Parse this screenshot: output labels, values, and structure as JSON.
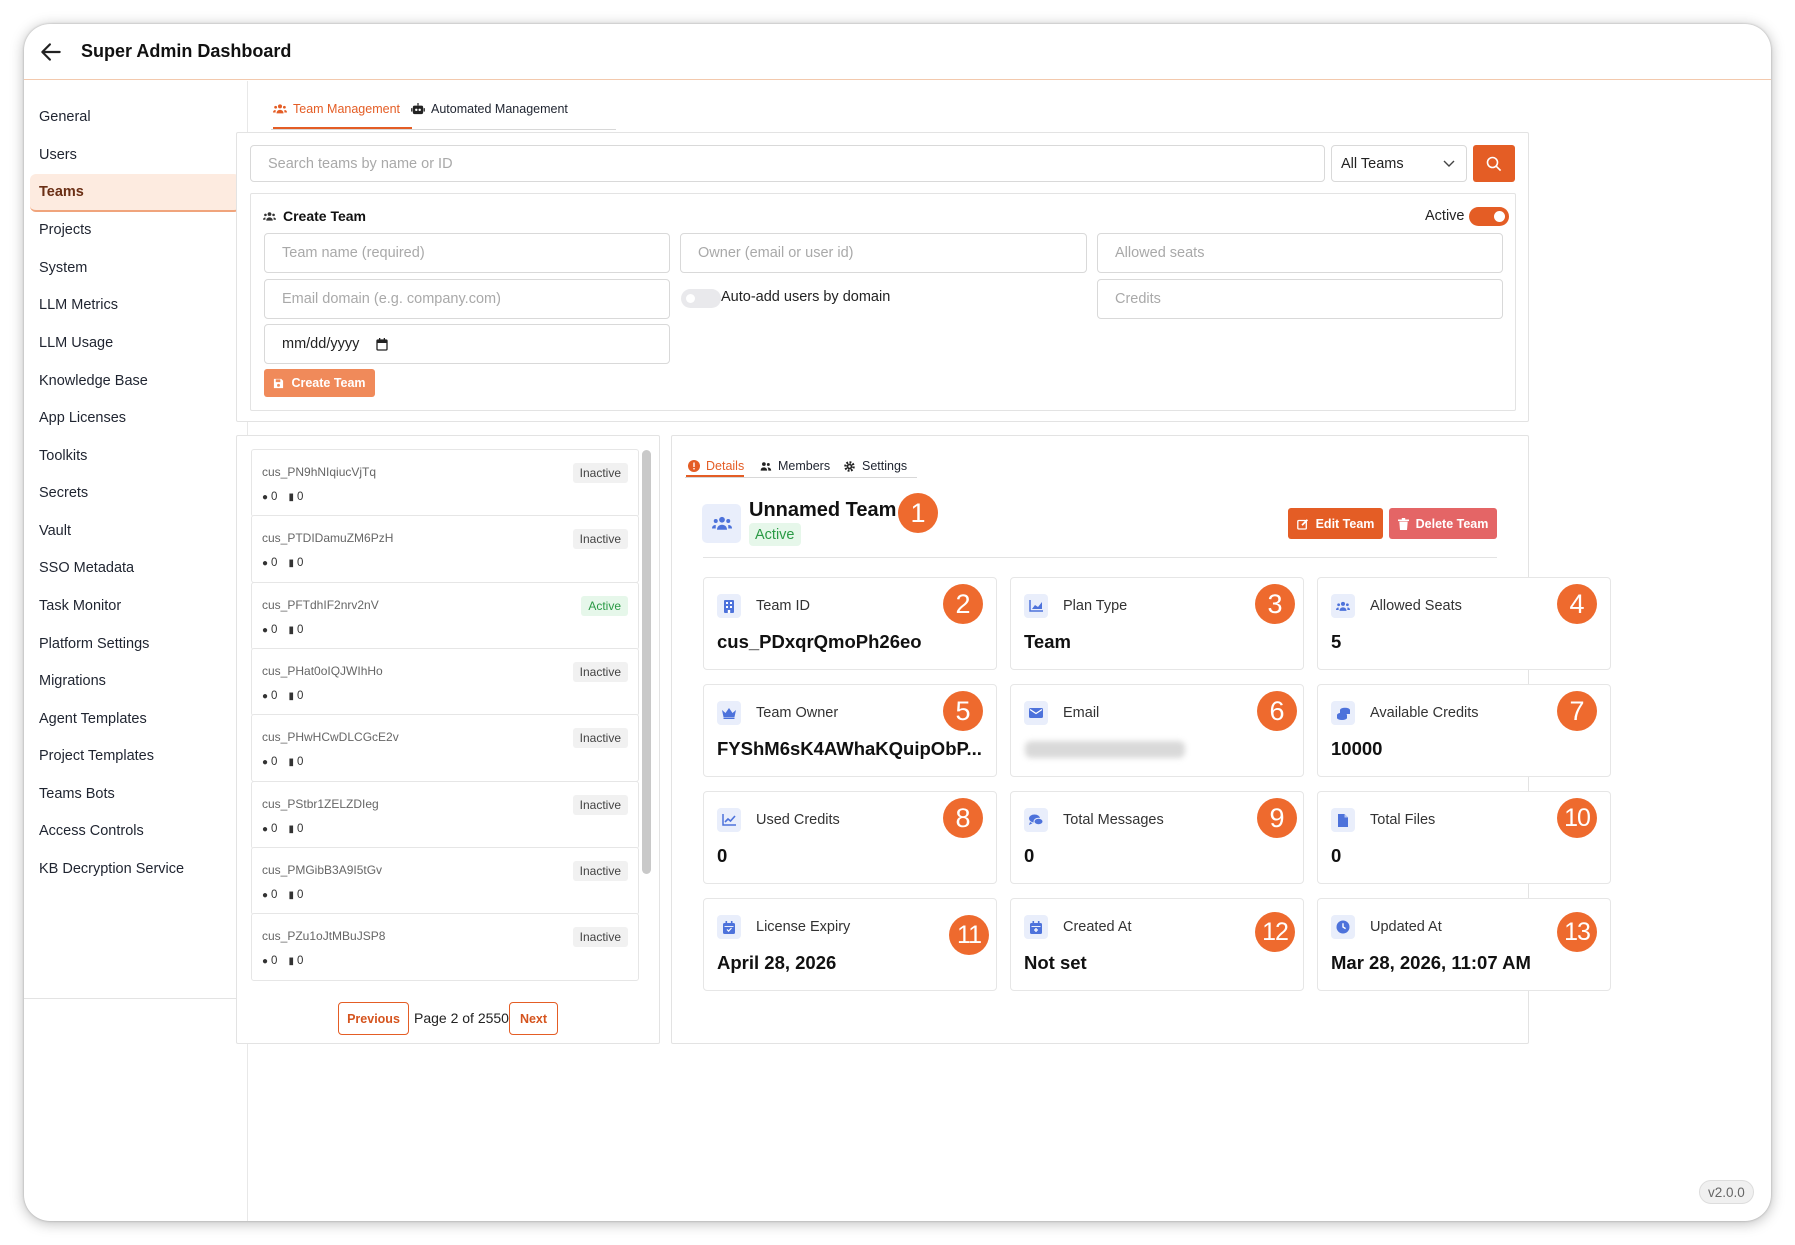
{
  "app": {
    "title": "Super Admin Dashboard",
    "version": "v2.0.0"
  },
  "sidebar": {
    "items": [
      {
        "label": "General"
      },
      {
        "label": "Users"
      },
      {
        "label": "Teams",
        "active": true
      },
      {
        "label": "Projects"
      },
      {
        "label": "System"
      },
      {
        "label": "LLM Metrics"
      },
      {
        "label": "LLM Usage"
      },
      {
        "label": "Knowledge Base"
      },
      {
        "label": "App Licenses"
      },
      {
        "label": "Toolkits"
      },
      {
        "label": "Secrets"
      },
      {
        "label": "Vault"
      },
      {
        "label": "SSO Metadata"
      },
      {
        "label": "Task Monitor"
      },
      {
        "label": "Platform Settings"
      },
      {
        "label": "Migrations"
      },
      {
        "label": "Agent Templates"
      },
      {
        "label": "Project Templates"
      },
      {
        "label": "Teams Bots"
      },
      {
        "label": "Access Controls"
      },
      {
        "label": "KB Decryption Service"
      }
    ]
  },
  "tabs": {
    "team_management": "Team Management",
    "automated_management": "Automated Management"
  },
  "search": {
    "placeholder": "Search teams by name or ID",
    "filter_value": "All Teams"
  },
  "create_team": {
    "heading": "Create Team",
    "active_label": "Active",
    "team_name_placeholder": "Team name (required)",
    "owner_placeholder": "Owner (email or user id)",
    "seats_placeholder": "Allowed seats",
    "email_domain_placeholder": "Email domain (e.g. company.com)",
    "auto_add_label": "Auto-add users by domain",
    "credits_placeholder": "Credits",
    "date_placeholder": "mm/dd/yyyy",
    "submit_label": "Create Team"
  },
  "team_list": {
    "items": [
      {
        "id": "cus_PN9hNIqiucVjTq",
        "status": "Inactive",
        "messages": "0",
        "files": "0"
      },
      {
        "id": "cus_PTDIDamuZM6PzH",
        "status": "Inactive",
        "messages": "0",
        "files": "0"
      },
      {
        "id": "cus_PFTdhIF2nrv2nV",
        "status": "Active",
        "messages": "0",
        "files": "0"
      },
      {
        "id": "cus_PHat0oIQJWIhHo",
        "status": "Inactive",
        "messages": "0",
        "files": "0"
      },
      {
        "id": "cus_PHwHCwDLCGcE2v",
        "status": "Inactive",
        "messages": "0",
        "files": "0"
      },
      {
        "id": "cus_PStbr1ZELZDIeg",
        "status": "Inactive",
        "messages": "0",
        "files": "0"
      },
      {
        "id": "cus_PMGibB3A9I5tGv",
        "status": "Inactive",
        "messages": "0",
        "files": "0"
      },
      {
        "id": "cus_PZu1oJtMBuJSP8",
        "status": "Inactive",
        "messages": "0",
        "files": "0"
      }
    ],
    "pagination": {
      "previous": "Previous",
      "page_text": "Page 2 of 2550",
      "next": "Next"
    }
  },
  "details": {
    "tabs": {
      "details": "Details",
      "members": "Members",
      "settings": "Settings"
    },
    "team_name": "Unnamed Team",
    "status": "Active",
    "edit_label": "Edit Team",
    "delete_label": "Delete Team",
    "name_marker": "1",
    "cards": [
      {
        "label": "Team ID",
        "value": "cus_PDxqrQmoPh26eo",
        "marker": "2",
        "icon": "building-icon"
      },
      {
        "label": "Plan Type",
        "value": "Team",
        "marker": "3",
        "icon": "chart-area-icon"
      },
      {
        "label": "Allowed Seats",
        "value": "5",
        "marker": "4",
        "icon": "users-icon"
      },
      {
        "label": "Team Owner",
        "value": "FYShM6sK4AWhaKQuipObP...",
        "marker": "5",
        "icon": "crown-icon"
      },
      {
        "label": "Email",
        "value": "",
        "marker": "6",
        "icon": "envelope-icon",
        "blurred": true
      },
      {
        "label": "Available Credits",
        "value": "10000",
        "marker": "7",
        "icon": "coins-icon"
      },
      {
        "label": "Used Credits",
        "value": "0",
        "marker": "8",
        "icon": "chart-line-icon"
      },
      {
        "label": "Total Messages",
        "value": "0",
        "marker": "9",
        "icon": "comments-icon"
      },
      {
        "label": "Total Files",
        "value": "0",
        "marker": "10",
        "icon": "file-icon"
      },
      {
        "label": "License Expiry",
        "value": "April 28, 2026",
        "marker": "11",
        "icon": "calendar-icon"
      },
      {
        "label": "Created At",
        "value": "Not set",
        "marker": "12",
        "icon": "calendar-plus-icon"
      },
      {
        "label": "Updated At",
        "value": "Mar 28, 2026, 11:07 AM",
        "marker": "13",
        "icon": "clock-icon"
      }
    ]
  },
  "colors": {
    "accent": "#e45d25",
    "danger": "#e46566",
    "active_green": "#2a9a45",
    "marker": "#ee6a2e"
  }
}
